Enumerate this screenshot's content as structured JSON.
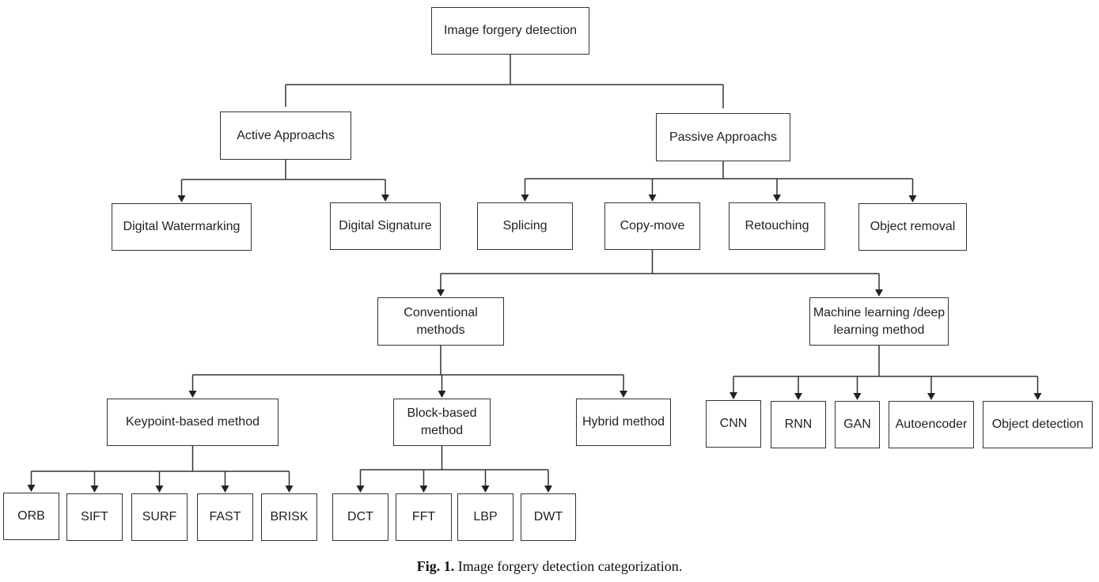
{
  "diagram": {
    "type": "tree",
    "nodes": [
      {
        "id": "root",
        "label": "Image forgery detection",
        "parent": null
      },
      {
        "id": "active",
        "label": "Active Approachs",
        "parent": "root"
      },
      {
        "id": "passive",
        "label": "Passive Approachs",
        "parent": "root"
      },
      {
        "id": "watermark",
        "label": "Digital Watermarking",
        "parent": "active"
      },
      {
        "id": "signature",
        "label": "Digital Signature",
        "parent": "active"
      },
      {
        "id": "splicing",
        "label": "Splicing",
        "parent": "passive"
      },
      {
        "id": "copymove",
        "label": "Copy-move",
        "parent": "passive"
      },
      {
        "id": "retouching",
        "label": "Retouching",
        "parent": "passive"
      },
      {
        "id": "objremoval",
        "label": "Object removal",
        "parent": "passive"
      },
      {
        "id": "conventional",
        "label": "Conventional methods",
        "parent": "copymove"
      },
      {
        "id": "mldl",
        "label": "Machine learning /deep learning method",
        "parent": "copymove"
      },
      {
        "id": "keypoint",
        "label": "Keypoint-based method",
        "parent": "conventional"
      },
      {
        "id": "block",
        "label": "Block-based method",
        "parent": "conventional"
      },
      {
        "id": "hybrid",
        "label": "Hybrid method",
        "parent": "conventional"
      },
      {
        "id": "orb",
        "label": "ORB",
        "parent": "keypoint"
      },
      {
        "id": "sift",
        "label": "SIFT",
        "parent": "keypoint"
      },
      {
        "id": "surf",
        "label": "SURF",
        "parent": "keypoint"
      },
      {
        "id": "fast",
        "label": "FAST",
        "parent": "keypoint"
      },
      {
        "id": "brisk",
        "label": "BRISK",
        "parent": "keypoint"
      },
      {
        "id": "dct",
        "label": "DCT",
        "parent": "block"
      },
      {
        "id": "fft",
        "label": "FFT",
        "parent": "block"
      },
      {
        "id": "lbp",
        "label": "LBP",
        "parent": "block"
      },
      {
        "id": "dwt",
        "label": "DWT",
        "parent": "block"
      },
      {
        "id": "cnn",
        "label": "CNN",
        "parent": "mldl"
      },
      {
        "id": "rnn",
        "label": "RNN",
        "parent": "mldl"
      },
      {
        "id": "gan",
        "label": "GAN",
        "parent": "mldl"
      },
      {
        "id": "autoencoder",
        "label": "Autoencoder",
        "parent": "mldl"
      },
      {
        "id": "objdetection",
        "label": "Object detection",
        "parent": "mldl"
      }
    ]
  },
  "caption": {
    "prefix": "Fig. 1.",
    "text": "Image forgery detection categorization."
  }
}
